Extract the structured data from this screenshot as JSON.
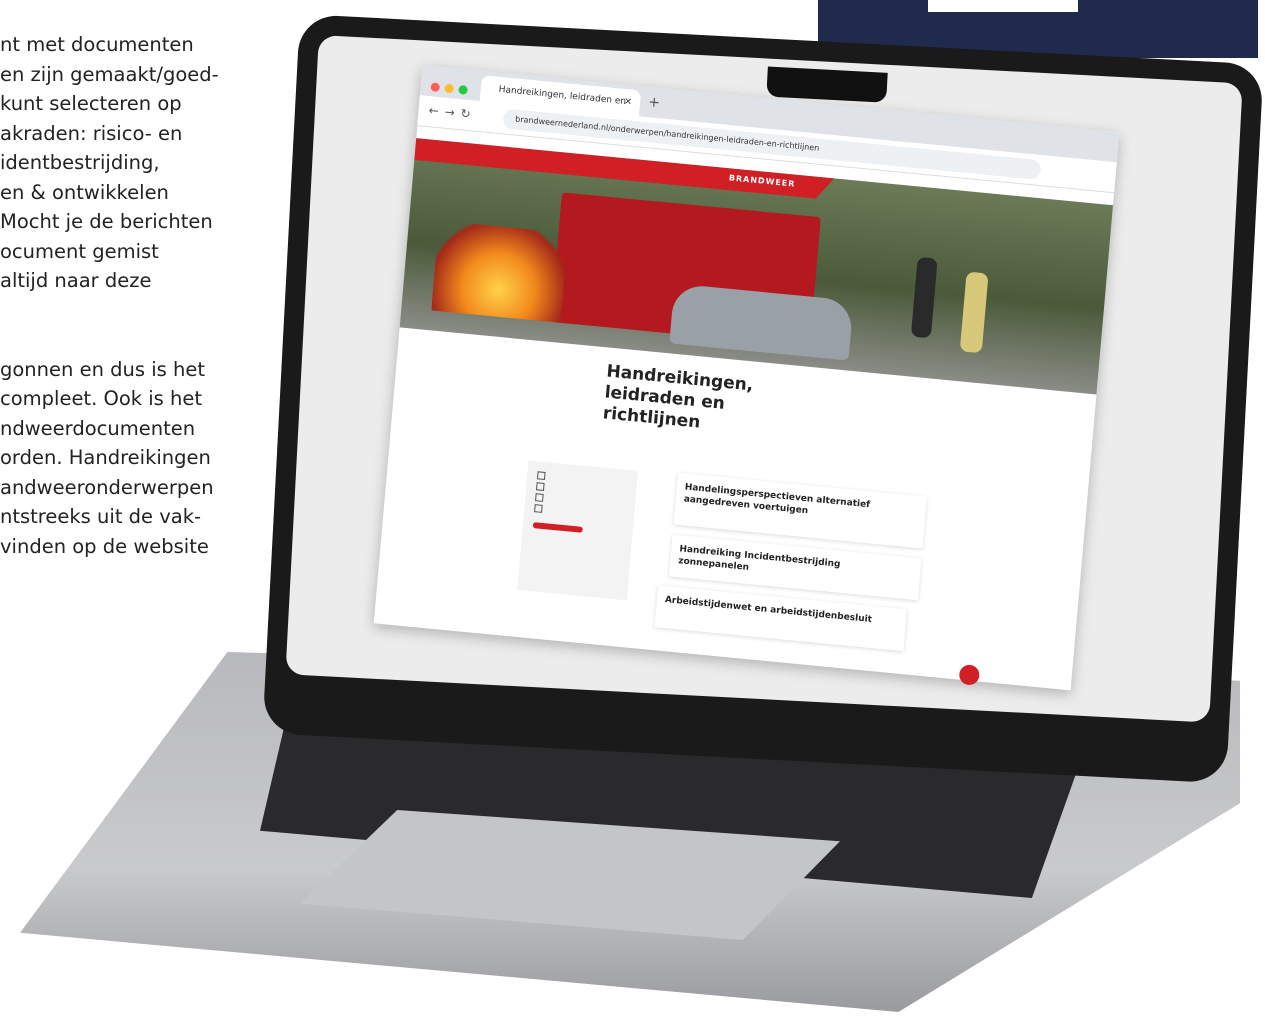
{
  "article": {
    "lines": [
      "nt met documenten",
      "en zijn gemaakt/goed-",
      "kunt selecteren op",
      "akraden: risico- en",
      "identbestrijding,",
      "en & ontwikkelen",
      "Mocht je de berichten",
      "ocument gemist",
      "altijd naar deze",
      "",
      "",
      "gonnen en dus is het",
      "compleet. Ook is het",
      "ndweerdocumenten",
      "orden. Handreikingen",
      "andweeronderwerpen",
      "ntstreeks uit de vak-",
      "vinden op de website"
    ]
  },
  "browser": {
    "tab_title": "Handreikingen, leidraden en",
    "url": "brandweernederland.nl/onderwerpen/handreikingen-leidraden-en-richtlijnen"
  },
  "site": {
    "logo": "BRANDWEER",
    "page_title": "Handreikingen, leidraden en richtlijnen",
    "cards": [
      {
        "title": "Handelingsperspectieven alternatief aangedreven voertuigen"
      },
      {
        "title": "Handreiking Incidentbestrijding zonnepanelen"
      },
      {
        "title": "Arbeidstijdenwet en arbeidstijdenbesluit"
      }
    ]
  },
  "colors": {
    "accent": "#d01f25",
    "navy": "#1f2a4d"
  }
}
